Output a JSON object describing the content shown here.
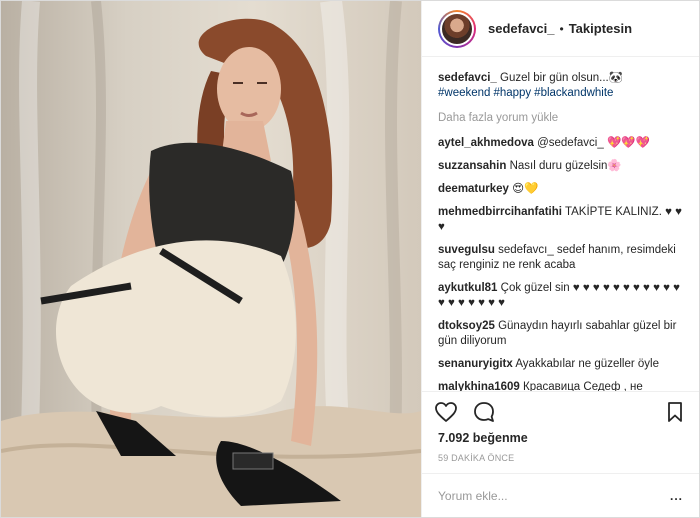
{
  "post": {
    "username": "sedefavci_",
    "follow_status": "Takiptesin",
    "caption_user": "sedefavci_",
    "caption_text": "Guzel bir gün olsun...🐼",
    "hashtags": [
      "#weekend",
      "#happy",
      "#blackandwhite"
    ],
    "load_more": "Daha fazla yorum yükle",
    "likes_count": "7.092",
    "likes_label": "beğenme",
    "time_ago": "59 DAKİKA ÖNCE",
    "comment_placeholder": "Yorum ekle...",
    "more_dots": "..."
  },
  "comments": [
    {
      "user": "aytel_akhmedova",
      "text": "@sedefavci_ 💖💖💖"
    },
    {
      "user": "suzzansahin",
      "text": "Nasıl duru güzelsin🌸"
    },
    {
      "user": "deematurkey",
      "text": "😍💛"
    },
    {
      "user": "mehmedbirrcihanfatihi",
      "text": "TAKİPTE KALINIZ. ♥ ♥ ♥"
    },
    {
      "user": "suvegulsu",
      "text": "sedefavcı_ sedef hanım, resimdeki saç renginiz ne renk acaba"
    },
    {
      "user": "aykutkul81",
      "text": "Çok güzel sin ♥ ♥ ♥ ♥ ♥ ♥ ♥ ♥ ♥ ♥ ♥ ♥ ♥ ♥ ♥ ♥ ♥ ♥"
    },
    {
      "user": "dtoksoy25",
      "text": "Günaydın hayırlı sabahlar güzel bir gün diliyorum"
    },
    {
      "user": "senanuryigitx",
      "text": "Ayakkabılar ne güzeller öyle"
    },
    {
      "user": "malykhina1609",
      "text": "Красавица Седеф , не перестаю любоваться . И муж красивый ."
    }
  ],
  "icons": {
    "like": "heart-icon",
    "comment": "comment-bubble-icon",
    "save": "bookmark-icon"
  }
}
